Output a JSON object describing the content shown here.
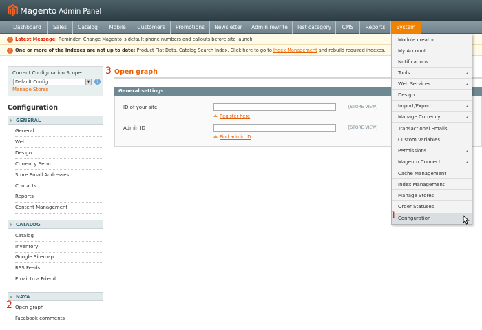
{
  "header": {
    "logo_main": "Magento",
    "logo_sub": "Admin Panel"
  },
  "nav": [
    {
      "label": "Dashboard"
    },
    {
      "label": "Sales"
    },
    {
      "label": "Catalog"
    },
    {
      "label": "Mobile"
    },
    {
      "label": "Customers"
    },
    {
      "label": "Promotions"
    },
    {
      "label": "Newsletter"
    },
    {
      "label": "Admin rewrite"
    },
    {
      "label": "Test category"
    },
    {
      "label": "CMS"
    },
    {
      "label": "Reports"
    },
    {
      "label": "System"
    }
  ],
  "messages": {
    "latest_label": "Latest Message:",
    "latest_text": "Reminder: Change Magento`s default phone numbers and callouts before site launch",
    "index_bold": "One or more of the Indexes are not up to date:",
    "index_text": "Product Flat Data, Catalog Search Index. Click here to go to",
    "index_link": "Index Management",
    "index_tail": "and rebuild required indexes."
  },
  "scope": {
    "label": "Current Configuration Scope:",
    "selected": "Default Config",
    "manage_link": "Manage Stores",
    "help": "?"
  },
  "sidebar": {
    "title": "Configuration",
    "sections": [
      {
        "label": "GENERAL",
        "items": [
          "General",
          "Web",
          "Design",
          "Currency Setup",
          "Store Email Addresses",
          "Contacts",
          "Reports",
          "Content Management"
        ]
      },
      {
        "label": "CATALOG",
        "items": [
          "Catalog",
          "Inventory",
          "Google Sitemap",
          "RSS Feeds",
          "Email to a Friend"
        ]
      },
      {
        "label": "NAYA",
        "items": [
          "Open graph",
          "Facebook comments"
        ]
      }
    ]
  },
  "main": {
    "title": "Open graph",
    "fieldset_title": "General settings",
    "fields": [
      {
        "label": "ID of your site",
        "value": "",
        "scope": "[STORE VIEW]",
        "link": "Register here"
      },
      {
        "label": "Admin ID",
        "value": "",
        "scope": "[STORE VIEW]",
        "link": "Find admin ID"
      }
    ]
  },
  "dropdown": {
    "items": [
      {
        "label": "Module creator",
        "sub": false
      },
      {
        "label": "My Account",
        "sub": false
      },
      {
        "label": "Notifications",
        "sub": false
      },
      {
        "label": "Tools",
        "sub": true
      },
      {
        "label": "Web Services",
        "sub": true
      },
      {
        "label": "Design",
        "sub": false
      },
      {
        "label": "Import/Export",
        "sub": true
      },
      {
        "label": "Manage Currency",
        "sub": true
      },
      {
        "label": "Transactional Emails",
        "sub": false
      },
      {
        "label": "Custom Variables",
        "sub": false
      },
      {
        "label": "Permissions",
        "sub": true
      },
      {
        "label": "Magento Connect",
        "sub": true
      },
      {
        "label": "Cache Management",
        "sub": false
      },
      {
        "label": "Index Management",
        "sub": false
      },
      {
        "label": "Manage Stores",
        "sub": false
      },
      {
        "label": "Order Statuses",
        "sub": false
      },
      {
        "label": "Configuration",
        "sub": false
      }
    ]
  },
  "annotations": {
    "step1": "1",
    "step2": "2",
    "step3": "3"
  },
  "colors": {
    "accent": "#eb5e00",
    "active_nav": "#f18200",
    "annotation": "#df280a"
  }
}
